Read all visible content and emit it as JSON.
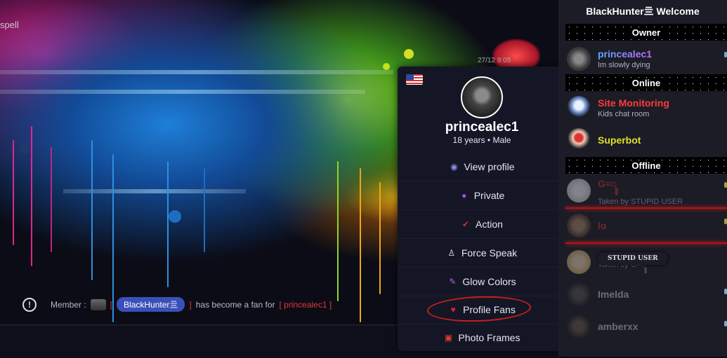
{
  "chat": {
    "top_left_text": "spell",
    "timestamp": "27/12 9:05",
    "notice": {
      "prefix": "Member :",
      "open_bracket": "[",
      "member": "BlackHunter亖",
      "close_bracket": "]",
      "message": "has become a fan for",
      "target": "[ princealec1 ]"
    }
  },
  "profile_popup": {
    "flag": "us-flag-icon",
    "username": "princealec1",
    "info": "18 years • Male",
    "menu": [
      {
        "label": "View profile",
        "icon": "user-circle-icon"
      },
      {
        "label": "Private",
        "icon": "chat-bubbles-icon"
      },
      {
        "label": "Action",
        "icon": "check-icon"
      },
      {
        "label": "Force Speak",
        "icon": "user-outline-icon"
      },
      {
        "label": "Glow Colors",
        "icon": "brush-icon"
      },
      {
        "label": "Profile Fans",
        "icon": "heart-icon"
      },
      {
        "label": "Photo Frames",
        "icon": "photo-icon"
      }
    ]
  },
  "user_panel": {
    "title": "BlackHunter亖 Welcome",
    "sections": {
      "owner": "Owner",
      "online": "Online",
      "offline": "Offline"
    },
    "owner_users": [
      {
        "name": "princealec1",
        "status": "Im slowly dying",
        "color": "#8a6cf0"
      }
    ],
    "online_users": [
      {
        "name": "Site Monitoring",
        "status": "Kids chat room",
        "color": "#ff3b3b"
      },
      {
        "name": "Superbot",
        "status": "",
        "color": "#e3e02a"
      }
    ],
    "offline_users": [
      {
        "name": "G≈ꦸ",
        "status": "Taken by STUPID USER",
        "color": "#d23030"
      },
      {
        "name": "lα",
        "status": "",
        "color": "#d23030"
      },
      {
        "name": "",
        "status": "Taken by G≈ꦸ",
        "color": "#cfcfcf"
      },
      {
        "name": "Imelda",
        "status": "",
        "color": "#cfcfcf"
      },
      {
        "name": "amberxx",
        "status": "",
        "color": "#cfcfcf"
      }
    ],
    "tag": "STUPID USER"
  }
}
